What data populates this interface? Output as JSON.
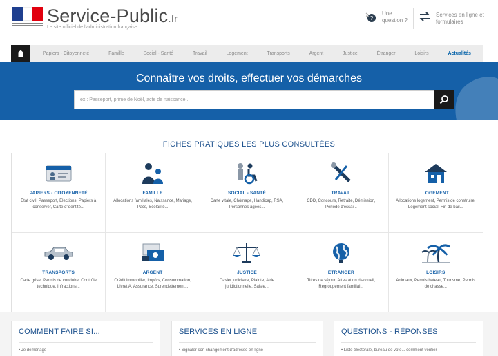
{
  "header": {
    "site_title": "Service-Public",
    "site_tld": ".fr",
    "tagline": "Le site officiel de l'administration française",
    "question_link": "Une question ?",
    "services_link": "Services en ligne et formulaires"
  },
  "nav": {
    "home_icon": "home-icon",
    "items": [
      {
        "label": "Papiers - Citoyenneté"
      },
      {
        "label": "Famille"
      },
      {
        "label": "Social - Santé"
      },
      {
        "label": "Travail"
      },
      {
        "label": "Logement"
      },
      {
        "label": "Transports"
      },
      {
        "label": "Argent"
      },
      {
        "label": "Justice"
      },
      {
        "label": "Étranger"
      },
      {
        "label": "Loisirs"
      },
      {
        "label": "Actualités"
      }
    ],
    "active_index": 10
  },
  "hero": {
    "title": "Connaître vos droits, effectuer vos démarches",
    "search_placeholder": "ex : Passeport, prime de Noël, acte de naissance..."
  },
  "fiches": {
    "title": "FICHES PRATIQUES LES PLUS CONSULTÉES",
    "cards": [
      {
        "title": "Papiers - Citoyenneté",
        "desc": "État civil, Passeport, Élections, Papiers à conserver, Carte d'identité...",
        "icon": "id-card-icon"
      },
      {
        "title": "Famille",
        "desc": "Allocations familiales, Naissance, Mariage, Pacs, Scolarité...",
        "icon": "family-icon"
      },
      {
        "title": "Social - Santé",
        "desc": "Carte vitale, Chômage, Handicap, RSA, Personnes âgées...",
        "icon": "handicap-icon"
      },
      {
        "title": "Travail",
        "desc": "CDD, Concours, Retraite, Démission, Période d'essai...",
        "icon": "tools-icon"
      },
      {
        "title": "Logement",
        "desc": "Allocations logement, Permis de construire, Logement social, Fin de bail...",
        "icon": "house-icon"
      },
      {
        "title": "Transports",
        "desc": "Carte grise, Permis de conduire, Contrôle technique, Infractions...",
        "icon": "car-icon"
      },
      {
        "title": "Argent",
        "desc": "Crédit immobilier, Impôts, Consommation, Livret A, Assurance, Surendettement...",
        "icon": "money-icon"
      },
      {
        "title": "Justice",
        "desc": "Casier judiciaire, Plainte, Aide juridictionnelle, Saisie...",
        "icon": "scales-icon"
      },
      {
        "title": "Étranger",
        "desc": "Titres de séjour, Attestation d'accueil, Regroupement familial...",
        "icon": "globe-icon"
      },
      {
        "title": "Loisirs",
        "desc": "Animaux, Permis bateau, Tourisme, Permis de chasse...",
        "icon": "palm-tree-icon"
      }
    ]
  },
  "panels": [
    {
      "title": "COMMENT FAIRE SI...",
      "first_item": "Je déménage"
    },
    {
      "title": "SERVICES EN LIGNE",
      "first_item": "Signaler son changement d'adresse en ligne"
    },
    {
      "title": "QUESTIONS - RÉPONSES",
      "first_item": "Liste électorale, bureau de vote... comment vérifier"
    }
  ],
  "colors": {
    "brand_blue": "#1560a8",
    "title_blue": "#1a4f8c",
    "flag_blue": "#1f3f8f",
    "flag_red": "#e1000f",
    "dark": "#1a1a1a"
  }
}
